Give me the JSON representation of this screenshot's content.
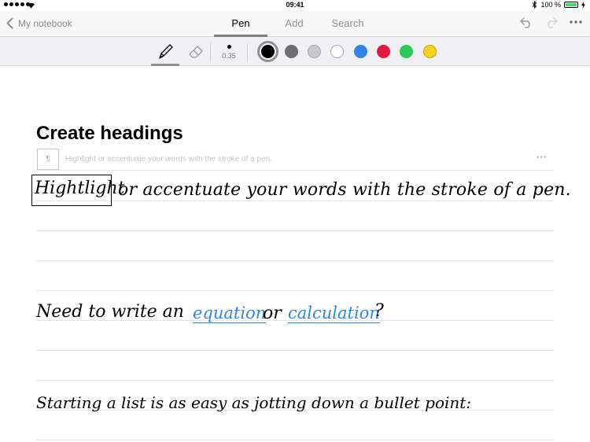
{
  "status_bar": {
    "time": "09:41",
    "battery": "100 %",
    "icons": [
      "signal-dots-icon",
      "wifi-icon",
      "bluetooth-icon",
      "battery-icon",
      "charging-icon"
    ]
  },
  "nav": {
    "back_label": "My notebook",
    "tabs": [
      {
        "label": "Pen",
        "active": true
      },
      {
        "label": "Add",
        "active": false
      },
      {
        "label": "Search",
        "active": false
      }
    ],
    "icons": [
      "chevron-left-icon",
      "undo-icon",
      "redo-icon",
      "more-icon"
    ]
  },
  "toolbar": {
    "pen_size": "0.35",
    "tools": [
      "pen-icon",
      "eraser-icon"
    ],
    "colors": [
      "#000000",
      "#6e6e6e",
      "#c8c8c8",
      "#ffffff",
      "#2f84e4",
      "#e8173d",
      "#2ec85a",
      "#f5d020"
    ],
    "selected_color": "#000000"
  },
  "note": {
    "heading": "Create headings",
    "placeholder": "Highlight or accentuate your words with the stroke of a pen.",
    "handwriting": {
      "line1_boxed": "Hightlight",
      "line1_rest": "or accentuate your words with the stroke of a pen.",
      "line2_a": "Need to write an",
      "line2_equation": "equation",
      "line2_or": "or",
      "line2_calc": "calculation",
      "line2_q": "?",
      "line3": "Starting a list is as easy as jotting down a bullet point:"
    }
  }
}
